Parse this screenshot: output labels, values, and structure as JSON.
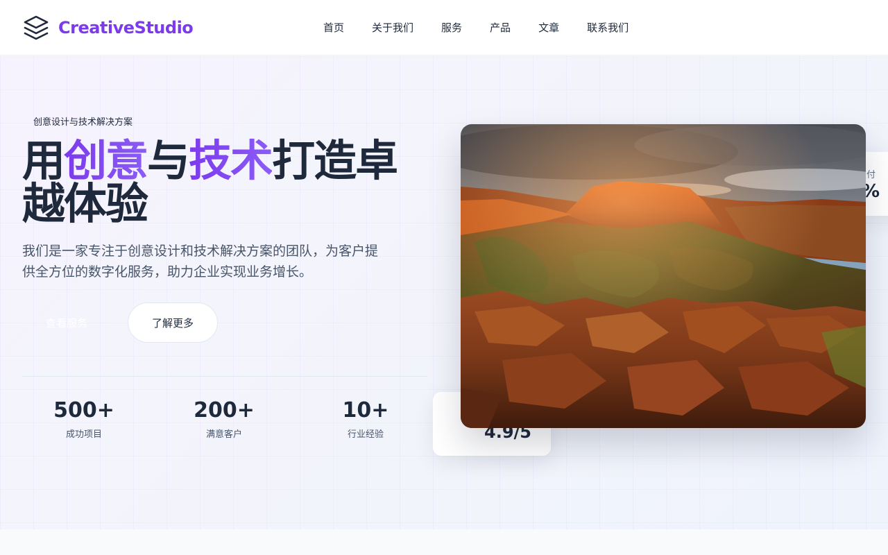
{
  "brand": {
    "name": "CreativeStudio",
    "accent_color": "#7c3aed",
    "icon": "stacked-layers-icon"
  },
  "nav": {
    "items": [
      "首页",
      "关于我们",
      "服务",
      "产品",
      "文章",
      "联系我们"
    ]
  },
  "hero": {
    "tagline": "创意设计与技术解决方案",
    "title_parts": {
      "p1": "用",
      "h1": "创意",
      "p2": "与",
      "h2": "技术",
      "p3": "打造卓越体验"
    },
    "description": "我们是一家专注于创意设计和技术解决方案的团队，为客户提供全方位的数字化服务，助力企业实现业务增长。",
    "primary_button": "查看服务",
    "secondary_button": "了解更多",
    "image_icon": "landscape-canyon-photo"
  },
  "stats": [
    {
      "value": "500+",
      "label": "成功项目"
    },
    {
      "value": "200+",
      "label": "满意客户"
    },
    {
      "value": "10+",
      "label": "行业经验"
    }
  ],
  "floating_cards": {
    "rating": {
      "value": "4.9/5"
    },
    "delivery": {
      "label": "交付",
      "value": "%"
    }
  }
}
